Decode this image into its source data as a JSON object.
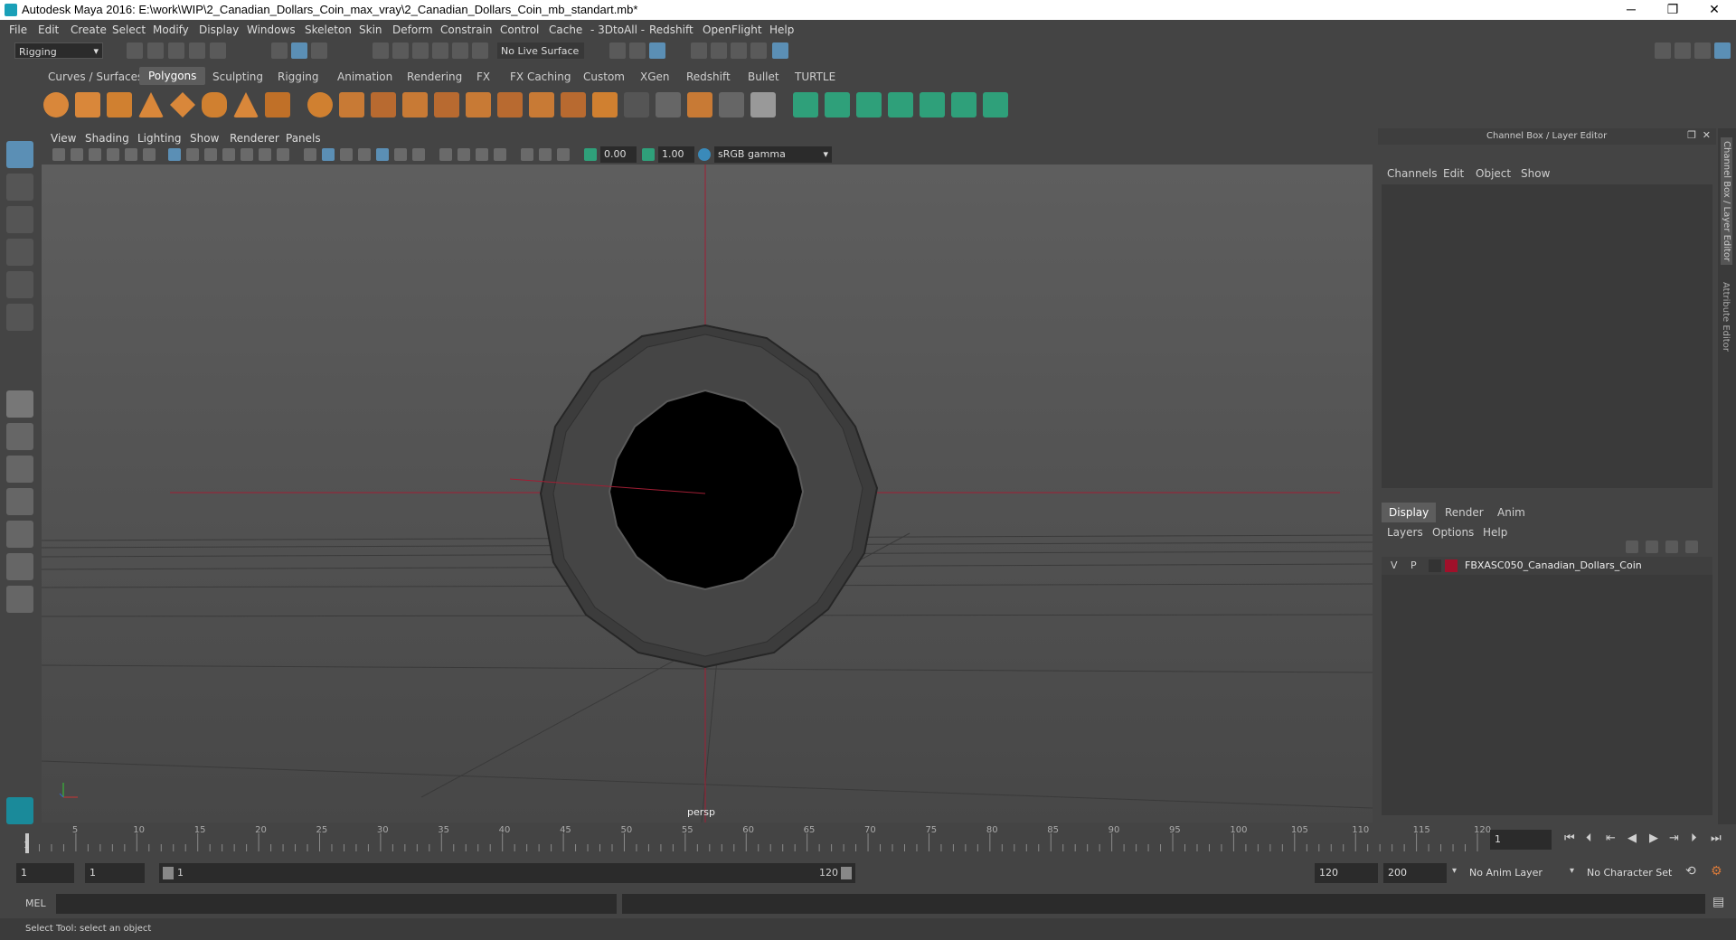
{
  "window": {
    "title": "Autodesk Maya 2016: E:\\work\\WIP\\2_Canadian_Dollars_Coin_max_vray\\2_Canadian_Dollars_Coin_mb_standart.mb*",
    "minimize": "─",
    "restore": "❐",
    "close": "✕"
  },
  "menubar": [
    "File",
    "Edit",
    "Create",
    "Select",
    "Modify",
    "Display",
    "Windows",
    "Skeleton",
    "Skin",
    "Deform",
    "Constrain",
    "Control",
    "Cache",
    "- 3DtoAll -",
    "Redshift",
    "OpenFlight",
    "Help"
  ],
  "status": {
    "mode": "Rigging",
    "live_surface": "No Live Surface"
  },
  "shelf_tabs": [
    "Curves / Surfaces",
    "Polygons",
    "Sculpting",
    "Rigging",
    "Animation",
    "Rendering",
    "FX",
    "FX Caching",
    "Custom",
    "XGen",
    "Redshift",
    "Bullet",
    "TURTLE"
  ],
  "shelf_selected": "Polygons",
  "panel_menu": [
    "View",
    "Shading",
    "Lighting",
    "Show",
    "Renderer",
    "Panels"
  ],
  "panel_bar": {
    "field1": "0.00",
    "field2": "1.00",
    "color_space": "sRGB gamma"
  },
  "viewport": {
    "camera_label": "persp"
  },
  "channel_box": {
    "title": "Channel Box / Layer Editor",
    "menu": [
      "Channels",
      "Edit",
      "Object",
      "Show"
    ]
  },
  "layer_editor": {
    "tabs": [
      "Display",
      "Render",
      "Anim"
    ],
    "active_tab": "Display",
    "menu": [
      "Layers",
      "Options",
      "Help"
    ],
    "layers": [
      {
        "v": "V",
        "p": "P",
        "color": "#a0102a",
        "name": "FBXASC050_Canadian_Dollars_Coin"
      }
    ]
  },
  "side_tabs": [
    "Channel Box / Layer Editor",
    "Attribute Editor"
  ],
  "timeline": {
    "ticks": [
      "5",
      "10",
      "15",
      "20",
      "25",
      "30",
      "35",
      "40",
      "45",
      "50",
      "55",
      "60",
      "65",
      "70",
      "75",
      "80",
      "85",
      "90",
      "95",
      "100",
      "105",
      "110",
      "115",
      "120"
    ],
    "current": "1",
    "frame_field": "1"
  },
  "range": {
    "start": "1",
    "start2": "1",
    "slider_start": "1",
    "slider_end": "120",
    "end": "120",
    "end2": "200",
    "anim_layer": "No Anim Layer",
    "char_set": "No Character Set"
  },
  "cmdline": {
    "label": "MEL"
  },
  "helpline": {
    "text": "Select Tool: select an object"
  }
}
